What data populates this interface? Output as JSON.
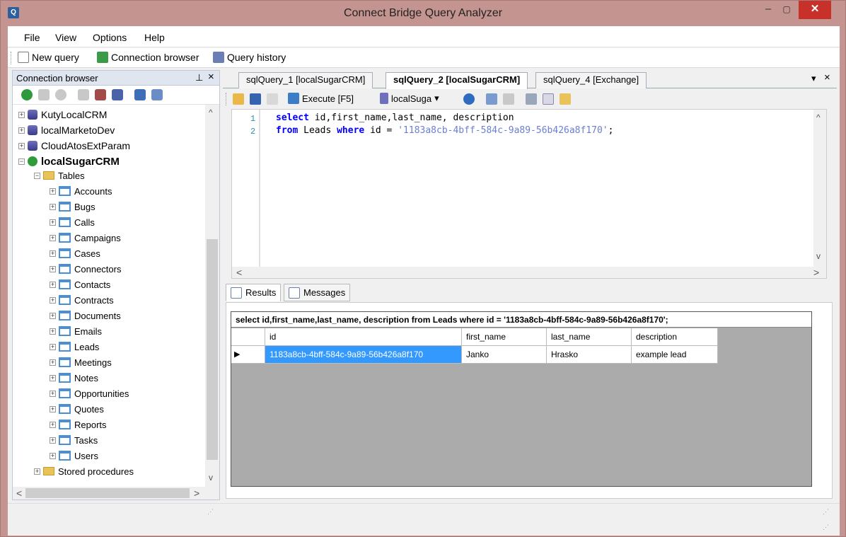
{
  "window": {
    "title": "Connect Bridge Query Analyzer"
  },
  "menu": [
    {
      "label": "File"
    },
    {
      "label": "View"
    },
    {
      "label": "Options"
    },
    {
      "label": "Help"
    }
  ],
  "toolbar": {
    "new_query": "New query",
    "connection_browser": "Connection browser",
    "query_history": "Query history"
  },
  "connection_browser": {
    "title": "Connection browser",
    "pin": "ᵽ",
    "close": "×",
    "connections": [
      {
        "label": "KutyLocalCRM"
      },
      {
        "label": "localMarketoDev"
      },
      {
        "label": "CloudAtosExtParam"
      }
    ],
    "active_connection": "localSugarCRM",
    "tables_folder": "Tables",
    "tables": [
      {
        "label": "Accounts"
      },
      {
        "label": "Bugs"
      },
      {
        "label": "Calls"
      },
      {
        "label": "Campaigns"
      },
      {
        "label": "Cases"
      },
      {
        "label": "Connectors"
      },
      {
        "label": "Contacts"
      },
      {
        "label": "Contracts"
      },
      {
        "label": "Documents"
      },
      {
        "label": "Emails"
      },
      {
        "label": "Leads"
      },
      {
        "label": "Meetings"
      },
      {
        "label": "Notes"
      },
      {
        "label": "Opportunities"
      },
      {
        "label": "Quotes"
      },
      {
        "label": "Reports"
      },
      {
        "label": "Tasks"
      },
      {
        "label": "Users"
      }
    ],
    "stored_procedures": "Stored procedures"
  },
  "tabs": [
    {
      "label": "sqlQuery_1 [localSugarCRM]",
      "active": false
    },
    {
      "label": "sqlQuery_2 [localSugarCRM]",
      "active": true
    },
    {
      "label": "sqlQuery_4 [Exchange]",
      "active": false
    }
  ],
  "query_toolbar": {
    "execute": "Execute [F5]",
    "connection": "localSuga"
  },
  "editor": {
    "lines": [
      {
        "num": "1",
        "kw1": "select",
        "rest1": " id,first_name,last_name, description"
      },
      {
        "num": "2",
        "kw1": "from",
        "mid": " Leads ",
        "kw2": "where",
        "rest2": " id = ",
        "str": "'1183a8cb-4bff-584c-9a89-56b426a8f170'",
        "end": ";"
      }
    ]
  },
  "results": {
    "tabs": {
      "results": "Results",
      "messages": "Messages"
    },
    "caption": "select id,first_name,last_name, description from Leads where id = '1183a8cb-4bff-584c-9a89-56b426a8f170';",
    "columns": [
      "id",
      "first_name",
      "last_name",
      "description"
    ],
    "rows": [
      [
        "1183a8cb-4bff-584c-9a89-56b426a8f170",
        "Janko",
        "Hrasko",
        "example lead"
      ]
    ],
    "row_marker": "▶"
  },
  "colors": {
    "accent": "#3399ff",
    "titlebar": "#c49490",
    "close": "#c8302a",
    "keyword": "#0000ff",
    "string": "#6b7fd1"
  }
}
